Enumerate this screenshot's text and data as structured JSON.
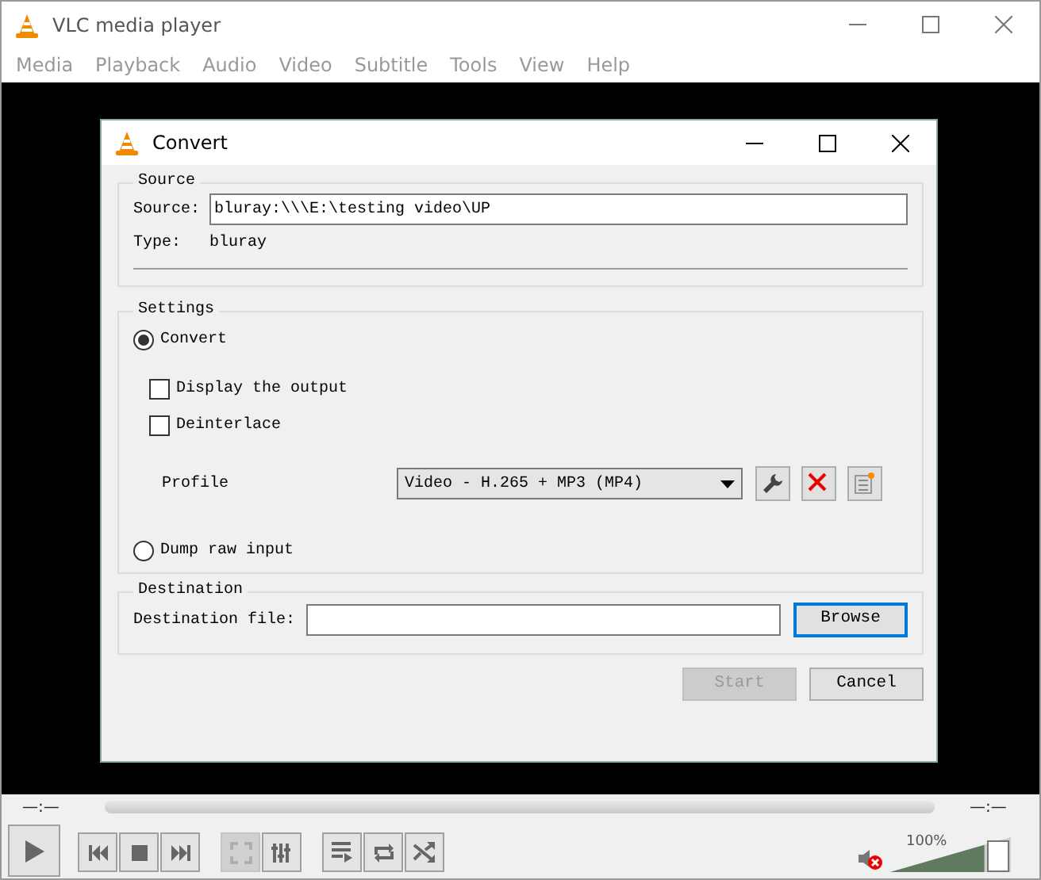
{
  "window": {
    "title": "VLC media player"
  },
  "menu": [
    "Media",
    "Playback",
    "Audio",
    "Video",
    "Subtitle",
    "Tools",
    "View",
    "Help"
  ],
  "dialog": {
    "title": "Convert",
    "source": {
      "legend": "Source",
      "source_label": "Source:",
      "source_value": "bluray:\\\\\\E:\\testing video\\UP",
      "type_label": "Type:",
      "type_value": "bluray"
    },
    "settings": {
      "legend": "Settings",
      "convert": {
        "label": "Convert",
        "selected": true
      },
      "options": [
        {
          "label": "Display the output",
          "checked": false
        },
        {
          "label": "Deinterlace",
          "checked": false
        }
      ],
      "profile_label": "Profile",
      "profile_value": "Video - H.265 + MP3 (MP4)",
      "dump": {
        "label": "Dump raw input",
        "selected": false
      }
    },
    "destination": {
      "legend": "Destination",
      "label": "Destination file:",
      "browse": {
        "label": "Browse",
        "focused": true
      }
    },
    "buttons": [
      {
        "label": "Start",
        "disabled": true
      },
      {
        "label": "Cancel",
        "disabled": false
      }
    ]
  },
  "controls": {
    "time_elapsed": "—:—",
    "time_total": "—:—",
    "buttons": [
      {
        "kind": "play",
        "disabled": false
      },
      {
        "kind": "previous",
        "disabled": false
      },
      {
        "kind": "stop",
        "disabled": false
      },
      {
        "kind": "next",
        "disabled": false
      },
      {
        "kind": "fullscreen",
        "disabled": true
      },
      {
        "kind": "equalizer",
        "disabled": false
      },
      {
        "kind": "playlist",
        "disabled": false
      },
      {
        "kind": "loop",
        "disabled": false
      },
      {
        "kind": "shuffle",
        "disabled": false
      }
    ],
    "volume": {
      "muted": true,
      "reading": "100%",
      "level": 1
    }
  }
}
